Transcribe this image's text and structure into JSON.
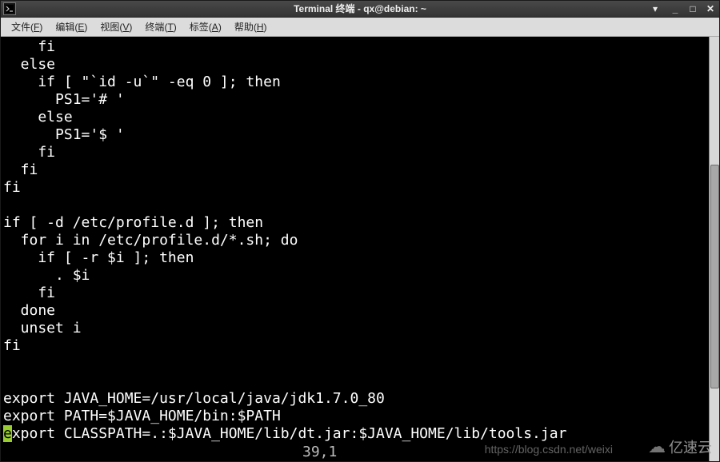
{
  "titlebar": {
    "title": "Terminal 终端 - qx@debian: ~"
  },
  "menubar": {
    "file": {
      "label": "文件",
      "accel": "F"
    },
    "edit": {
      "label": "编辑",
      "accel": "E"
    },
    "view": {
      "label": "视图",
      "accel": "V"
    },
    "term": {
      "label": "终端",
      "accel": "T"
    },
    "tabs": {
      "label": "标签",
      "accel": "A"
    },
    "help": {
      "label": "帮助",
      "accel": "H"
    }
  },
  "terminal": {
    "lines": [
      "    fi",
      "  else",
      "    if [ \"`id -u`\" -eq 0 ]; then",
      "      PS1='# '",
      "    else",
      "      PS1='$ '",
      "    fi",
      "  fi",
      "fi",
      "",
      "if [ -d /etc/profile.d ]; then",
      "  for i in /etc/profile.d/*.sh; do",
      "    if [ -r $i ]; then",
      "      . $i",
      "    fi",
      "  done",
      "  unset i",
      "fi",
      "",
      "",
      "export JAVA_HOME=/usr/local/java/jdk1.7.0_80",
      "export PATH=$JAVA_HOME/bin:$PATH"
    ],
    "cursor_line_prefix_char": "e",
    "cursor_line_rest": "xport CLASSPATH=.:$JAVA_HOME/lib/dt.jar:$JAVA_HOME/lib/tools.jar",
    "status_position": "39,1"
  },
  "watermarks": {
    "csdn": "https://blog.csdn.net/weixi",
    "yisu": "亿速云"
  }
}
